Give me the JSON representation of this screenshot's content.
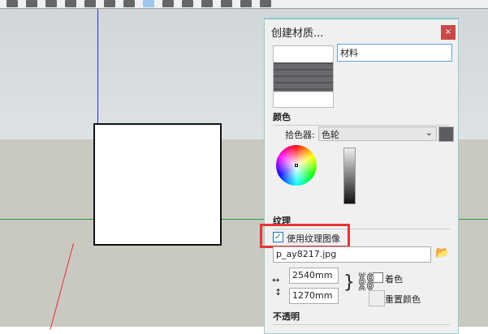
{
  "dialog": {
    "title": "创建材质...",
    "close": "×",
    "name_value": "材料",
    "color_section": "颜色",
    "picker_label": "拾色器:",
    "picker_value": "色轮",
    "swatch_color": "#5e5c60",
    "texture_section": "纹理",
    "use_texture": "使用纹理图像",
    "use_texture_checked": true,
    "texture_file": "p_ay8217.jpg",
    "width": "2540mm",
    "height": "1270mm",
    "colorize": "着色",
    "reset_color": "重置颜色",
    "opacity_section": "不透明"
  }
}
